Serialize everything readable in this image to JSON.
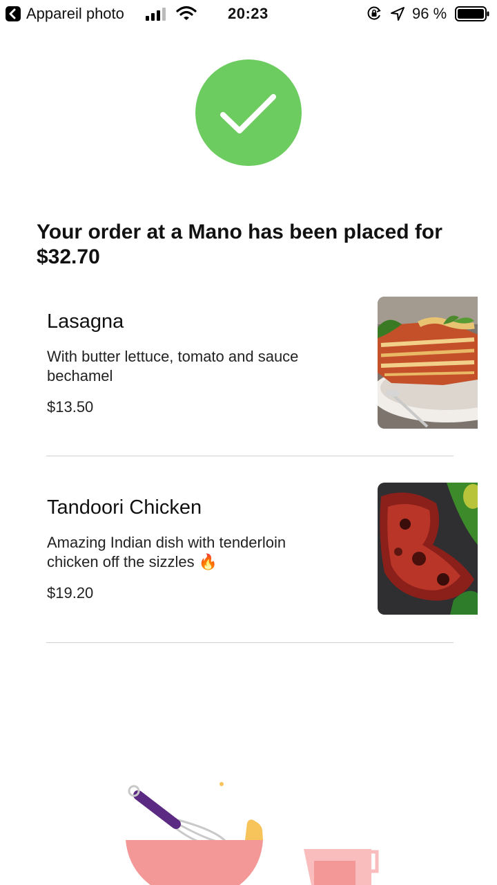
{
  "status_bar": {
    "carrier": "Appareil photo",
    "time": "20:23",
    "battery": "96 %"
  },
  "headline": {
    "line1": "Your order at a Mano has been placed for",
    "line2": "$32.70"
  },
  "order_items": [
    {
      "name": "Lasagna",
      "description_line1": "With butter lettuce, tomato and sauce",
      "description_line2": "bechamel",
      "price": "$13.50"
    },
    {
      "name": "Tandoori Chicken",
      "description_line1": "Amazing Indian dish with tenderloin",
      "description_line2": "chicken off the sizzles 🔥",
      "price": "$19.20"
    }
  ],
  "colors": {
    "success_green": "#6dcc60",
    "bowl_pink": "#f49797",
    "whisk_handle": "#5b2a83",
    "divider": "#cfcfcf"
  }
}
